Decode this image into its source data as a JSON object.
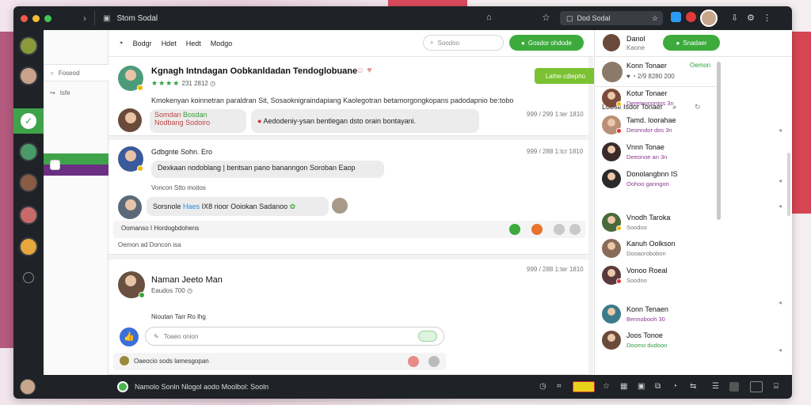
{
  "browser": {
    "tab_title": "Stom Sodal",
    "address": "Dod Sodal"
  },
  "nav": {
    "items": [
      "Bodgr",
      "Hdet",
      "Hedt",
      "Modgo"
    ],
    "search_placeholder": "Soodoo",
    "action_label": "Gosdor ohdode"
  },
  "sidebar": {
    "items": [
      {
        "icon": "circle-icon",
        "label": "Foseod"
      },
      {
        "icon": "share-icon",
        "label": "Isfe"
      }
    ]
  },
  "feed": {
    "post1": {
      "title": "Kgnagh Intndagan Oobkanldadan Tendoglobuane",
      "rating_stars": "★★★★",
      "meta": "231 2812",
      "text": "Kmokenyan koinnetran paraldran Sit, Sosaoknigraindapiang Kaolegotran betamorgongkopans padodapnio be:tobo",
      "reply_chips": [
        "Somdan",
        "Bosdan",
        "Nodbang",
        "Sodoiro"
      ],
      "reply_text": "Aedodeniy-ysan bentlegan dsto orain bontayani.",
      "timestamp": "999 / 299 1:ter 1810",
      "button_label": "Lathe cdiepho"
    },
    "post2": {
      "author": "Gdbgnte Sohn. Ero",
      "timestamp": "999 / 288 1:tcr 1810",
      "text": "Dexkaan nodoblang | bentsan pano bananngon Soroban Eaop",
      "subtext": "Voncon Stto moitos",
      "comment_author": "Sorsnole",
      "comment_link": "Haes",
      "comment_text": "IX8 rioor Ooiokan Sadanoo",
      "footer_text": "Oomanso I Hordogbdohens",
      "footer_text2": "Oemon ad Doncon isa"
    },
    "post3": {
      "author": "Naman Jeeto Man",
      "meta": "Eaudos 700",
      "timestamp": "999 / 288 1:ter 1810",
      "sub": "Nioutan Tarr Ro lhg",
      "comment_placeholder": "Toaeo onion",
      "footer_text": "Oaeocio sods lamesgopan"
    }
  },
  "right": {
    "profile": {
      "name": "Danol",
      "sub": "Kaone"
    },
    "top_action": "Snadaer",
    "featured": {
      "name": "Konn Tonaer",
      "meta": "2/9 8280 200",
      "status": "Oemon"
    },
    "header": "Loose Isdor Tonaer",
    "contacts": [
      {
        "name": "Kotur Tonaer",
        "status": "Deremonontos 3n",
        "status_color": "#8a3b91",
        "dot": "#f5b400"
      },
      {
        "name": "Tamd. Ioorahae",
        "status": "Deonndor dos 3n",
        "status_color": "#8a3b91",
        "dot": "#d33"
      },
      {
        "name": "Vnnn Tonae",
        "status": "Deeonoe an 3n",
        "status_color": "#8a3b91",
        "dot": ""
      },
      {
        "name": "Donolangbnn IS",
        "status": "Oohoo ganngon",
        "status_color": "#8a3b91",
        "dot": ""
      },
      {
        "name": "Vnodh Taroka",
        "status": "Soodoo",
        "status_color": "#777",
        "dot": "#f5b400"
      },
      {
        "name": "Kanuh Oolkson",
        "status": "Dooaorobobon",
        "status_color": "#777",
        "dot": ""
      },
      {
        "name": "Vonoo Roeal",
        "status": "Soodno",
        "status_color": "#777",
        "dot": "#d33"
      },
      {
        "name": "Konn Tenaen",
        "status": "Bennobooh 30",
        "status_color": "#8a3b91",
        "dot": ""
      },
      {
        "name": "Joos Tonoe",
        "status": "Doomo dudooo",
        "status_color": "#2f9e3e",
        "dot": ""
      }
    ]
  },
  "bottom": {
    "status_text": "Namolo Sonln   Nlogol aodo   Moolbol: Sooln"
  },
  "colors": {
    "accent_green": "#3cab3c",
    "rail_dark": "#1f2226",
    "brand_purple": "#6a2f82"
  }
}
